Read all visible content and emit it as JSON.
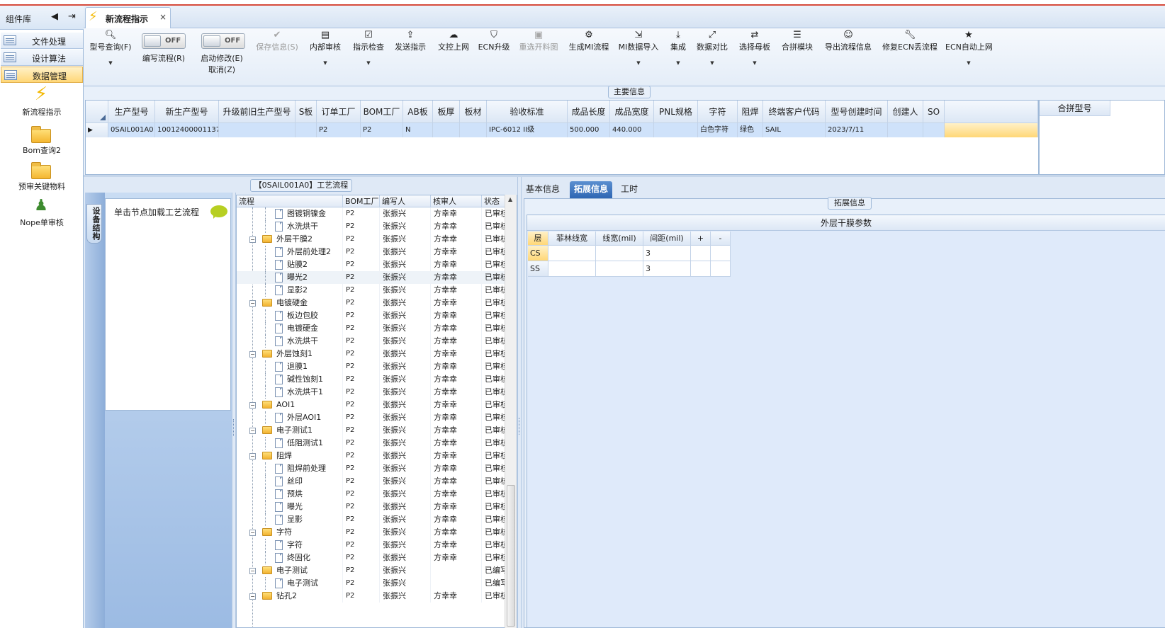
{
  "left_panel": {
    "title": "组件库",
    "nav": [
      {
        "label": "文件处理"
      },
      {
        "label": "设计算法"
      },
      {
        "label": "数据管理"
      }
    ],
    "items": [
      {
        "label": "新流程指示",
        "icon": "lightning-icon"
      },
      {
        "label": "Bom查询2",
        "icon": "folder-icon"
      },
      {
        "label": "预审关键物料",
        "icon": "folder-icon"
      },
      {
        "label": "Nope单审核",
        "icon": "user-icon"
      }
    ]
  },
  "tab": {
    "label": "新流程指示",
    "close": "×"
  },
  "toolbar": {
    "query": "型号查询(F)",
    "write_flow": "编写流程(R)",
    "auto_modify": "启动修改(E)",
    "cancel": "取消(Z)",
    "toggle_off": "OFF",
    "save": "保存信息(S)",
    "internal_review": "内部审核",
    "indicator_check": "指示检查",
    "send": "发送指示",
    "doc_upload": "文控上网",
    "ecn_upgrade": "ECN升级",
    "reselect": "重选开料图",
    "gen_mi": "生成MI流程",
    "mi_import": "MI数据导入",
    "integrate": "集成",
    "compare": "数据对比",
    "select_master": "选择母板",
    "merge_module": "合拼模块",
    "export_flow": "导出流程信息",
    "fix_ecn": "修复ECN丢流程",
    "ecn_auto": "ECN自动上网"
  },
  "main_info": {
    "legend": "主要信息",
    "columns": [
      "生产型号",
      "新生产型号",
      "升级前旧生产型号",
      "S板",
      "订单工厂",
      "BOM工厂",
      "AB板",
      "板厚",
      "板材",
      "验收标准",
      "成品长度",
      "成品宽度",
      "PNL规格",
      "字符",
      "阻焊",
      "终端客户代码",
      "型号创建时间",
      "创建人",
      "SO"
    ],
    "row": [
      "0SAIL001A0",
      "10012400001137",
      "",
      "",
      "P2",
      "P2",
      "N",
      "",
      "",
      "IPC-6012 II级",
      "500.000",
      "440.000",
      "",
      "白色字符",
      "绿色",
      "SAIL",
      "2023/7/11",
      "",
      ""
    ],
    "merge_column": "合拼型号"
  },
  "flow": {
    "legend": "【0SAIL001A0】工艺流程",
    "side_tab": "设备结构",
    "node_hint": "单击节点加载工艺流程",
    "columns": [
      "流程",
      "BOM工厂",
      "编写人",
      "核审人",
      "状态"
    ],
    "rows": [
      {
        "name": "图镀铜镍金",
        "level": 2,
        "factory": "P2",
        "writer": "张振兴",
        "reviewer": "方幸幸",
        "status": "已审核"
      },
      {
        "name": "水洗烘干",
        "level": 2,
        "factory": "P2",
        "writer": "张振兴",
        "reviewer": "方幸幸",
        "status": "已审核"
      },
      {
        "name": "外层干膜2",
        "level": 1,
        "factory": "P2",
        "writer": "张振兴",
        "reviewer": "方幸幸",
        "status": "已审核"
      },
      {
        "name": "外层前处理2",
        "level": 2,
        "factory": "P2",
        "writer": "张振兴",
        "reviewer": "方幸幸",
        "status": "已审核"
      },
      {
        "name": "贴膜2",
        "level": 2,
        "factory": "P2",
        "writer": "张振兴",
        "reviewer": "方幸幸",
        "status": "已审核"
      },
      {
        "name": "曝光2",
        "level": 2,
        "factory": "P2",
        "writer": "张振兴",
        "reviewer": "方幸幸",
        "status": "已审核",
        "selected": true
      },
      {
        "name": "显影2",
        "level": 2,
        "factory": "P2",
        "writer": "张振兴",
        "reviewer": "方幸幸",
        "status": "已审核"
      },
      {
        "name": "电镀硬金",
        "level": 1,
        "factory": "P2",
        "writer": "张振兴",
        "reviewer": "方幸幸",
        "status": "已审核"
      },
      {
        "name": "板边包胶",
        "level": 2,
        "factory": "P2",
        "writer": "张振兴",
        "reviewer": "方幸幸",
        "status": "已审核"
      },
      {
        "name": "电镀硬金",
        "level": 2,
        "factory": "P2",
        "writer": "张振兴",
        "reviewer": "方幸幸",
        "status": "已审核"
      },
      {
        "name": "水洗烘干",
        "level": 2,
        "factory": "P2",
        "writer": "张振兴",
        "reviewer": "方幸幸",
        "status": "已审核"
      },
      {
        "name": "外层蚀刻1",
        "level": 1,
        "factory": "P2",
        "writer": "张振兴",
        "reviewer": "方幸幸",
        "status": "已审核"
      },
      {
        "name": "退膜1",
        "level": 2,
        "factory": "P2",
        "writer": "张振兴",
        "reviewer": "方幸幸",
        "status": "已审核"
      },
      {
        "name": "碱性蚀刻1",
        "level": 2,
        "factory": "P2",
        "writer": "张振兴",
        "reviewer": "方幸幸",
        "status": "已审核"
      },
      {
        "name": "水洗烘干1",
        "level": 2,
        "factory": "P2",
        "writer": "张振兴",
        "reviewer": "方幸幸",
        "status": "已审核"
      },
      {
        "name": "AOI1",
        "level": 1,
        "factory": "P2",
        "writer": "张振兴",
        "reviewer": "方幸幸",
        "status": "已审核"
      },
      {
        "name": "外层AOI1",
        "level": 2,
        "factory": "P2",
        "writer": "张振兴",
        "reviewer": "方幸幸",
        "status": "已审核"
      },
      {
        "name": "电子测试1",
        "level": 1,
        "factory": "P2",
        "writer": "张振兴",
        "reviewer": "方幸幸",
        "status": "已审核"
      },
      {
        "name": "低阻测试1",
        "level": 2,
        "factory": "P2",
        "writer": "张振兴",
        "reviewer": "方幸幸",
        "status": "已审核"
      },
      {
        "name": "阻焊",
        "level": 1,
        "factory": "P2",
        "writer": "张振兴",
        "reviewer": "方幸幸",
        "status": "已审核"
      },
      {
        "name": "阻焊前处理",
        "level": 2,
        "factory": "P2",
        "writer": "张振兴",
        "reviewer": "方幸幸",
        "status": "已审核"
      },
      {
        "name": "丝印",
        "level": 2,
        "factory": "P2",
        "writer": "张振兴",
        "reviewer": "方幸幸",
        "status": "已审核"
      },
      {
        "name": "预烘",
        "level": 2,
        "factory": "P2",
        "writer": "张振兴",
        "reviewer": "方幸幸",
        "status": "已审核"
      },
      {
        "name": "曝光",
        "level": 2,
        "factory": "P2",
        "writer": "张振兴",
        "reviewer": "方幸幸",
        "status": "已审核"
      },
      {
        "name": "显影",
        "level": 2,
        "factory": "P2",
        "writer": "张振兴",
        "reviewer": "方幸幸",
        "status": "已审核"
      },
      {
        "name": "字符",
        "level": 1,
        "factory": "P2",
        "writer": "张振兴",
        "reviewer": "方幸幸",
        "status": "已审核"
      },
      {
        "name": "字符",
        "level": 2,
        "factory": "P2",
        "writer": "张振兴",
        "reviewer": "方幸幸",
        "status": "已审核"
      },
      {
        "name": "终固化",
        "level": 2,
        "factory": "P2",
        "writer": "张振兴",
        "reviewer": "方幸幸",
        "status": "已审核"
      },
      {
        "name": "电子测试",
        "level": 1,
        "factory": "P2",
        "writer": "张振兴",
        "reviewer": "",
        "status": "已编写"
      },
      {
        "name": "电子测试",
        "level": 2,
        "factory": "P2",
        "writer": "张振兴",
        "reviewer": "",
        "status": "已编写"
      },
      {
        "name": "钻孔2",
        "level": 1,
        "factory": "P2",
        "writer": "张振兴",
        "reviewer": "方幸幸",
        "status": "已审核"
      }
    ]
  },
  "right": {
    "tabs": [
      "基本信息",
      "拓展信息",
      "工时"
    ],
    "active_tab": "拓展信息",
    "legend": "拓展信息",
    "film": {
      "title": "外层干膜参数",
      "columns": [
        "层",
        "菲林线宽",
        "线宽(mil)",
        "间距(mil)",
        "+",
        "-"
      ],
      "rows": [
        [
          "CS",
          "",
          "",
          "3",
          "",
          ""
        ],
        [
          "SS",
          "",
          "",
          "3",
          "",
          ""
        ]
      ]
    }
  }
}
